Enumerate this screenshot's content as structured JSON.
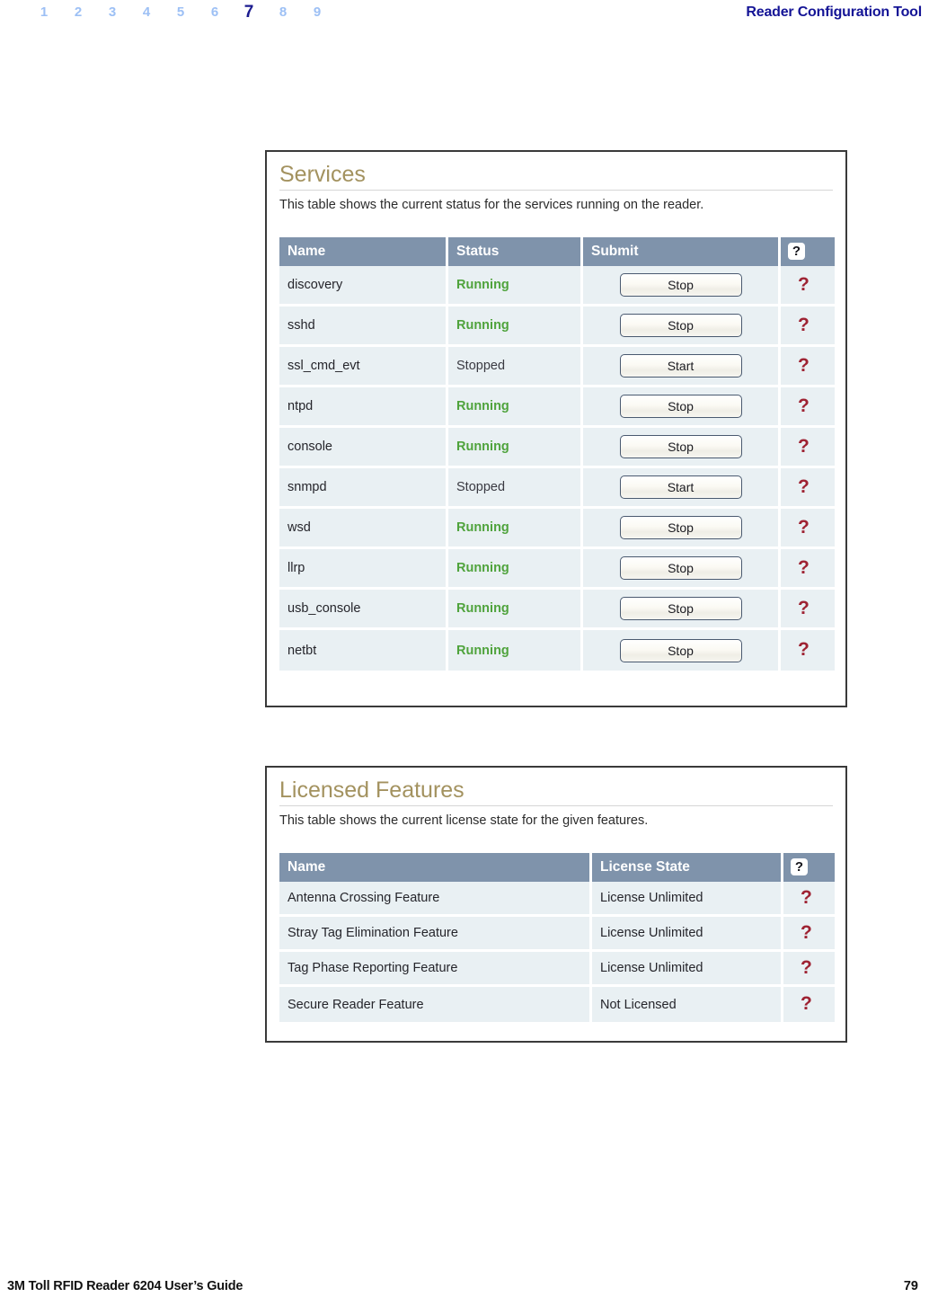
{
  "header": {
    "chapters": [
      "1",
      "2",
      "3",
      "4",
      "5",
      "6",
      "7",
      "8",
      "9"
    ],
    "current_chapter": "7",
    "title": "Reader Configuration Tool"
  },
  "services_panel": {
    "title": "Services",
    "description": "This table shows the current status for the services running on the reader.",
    "columns": {
      "name": "Name",
      "status": "Status",
      "submit": "Submit",
      "help": "?"
    },
    "rows": [
      {
        "name": "discovery",
        "status": "Running",
        "state": "running",
        "button": "Stop",
        "help": "?"
      },
      {
        "name": "sshd",
        "status": "Running",
        "state": "running",
        "button": "Stop",
        "help": "?"
      },
      {
        "name": "ssl_cmd_evt",
        "status": "Stopped",
        "state": "stopped",
        "button": "Start",
        "help": "?"
      },
      {
        "name": "ntpd",
        "status": "Running",
        "state": "running",
        "button": "Stop",
        "help": "?"
      },
      {
        "name": "console",
        "status": "Running",
        "state": "running",
        "button": "Stop",
        "help": "?"
      },
      {
        "name": "snmpd",
        "status": "Stopped",
        "state": "stopped",
        "button": "Start",
        "help": "?"
      },
      {
        "name": "wsd",
        "status": "Running",
        "state": "running",
        "button": "Stop",
        "help": "?"
      },
      {
        "name": "llrp",
        "status": "Running",
        "state": "running",
        "button": "Stop",
        "help": "?"
      },
      {
        "name": "usb_console",
        "status": "Running",
        "state": "running",
        "button": "Stop",
        "help": "?"
      },
      {
        "name": "netbt",
        "status": "Running",
        "state": "running",
        "button": "Stop",
        "help": "?"
      }
    ]
  },
  "licensed_panel": {
    "title": "Licensed Features",
    "description": "This table shows the current license state for the given features.",
    "columns": {
      "name": "Name",
      "state": "License State",
      "help": "?"
    },
    "rows": [
      {
        "name": "Antenna Crossing Feature",
        "state": "License Unlimited",
        "help": "?"
      },
      {
        "name": "Stray Tag Elimination Feature",
        "state": "License Unlimited",
        "help": "?"
      },
      {
        "name": "Tag Phase Reporting Feature",
        "state": "License Unlimited",
        "help": "?"
      },
      {
        "name": "Secure Reader Feature",
        "state": "Not Licensed",
        "help": "?"
      }
    ]
  },
  "footer": {
    "guide": "3M Toll RFID Reader 6204 User’s Guide",
    "page": "79"
  },
  "colors": {
    "table_header_bg": "#7f93ab",
    "row_bg": "#e9f0f3",
    "status_running": "#4fa33c",
    "status_stopped": "#3a3a42",
    "panel_title": "#a3925f",
    "help_mark": "#9e2232",
    "chapter_current": "#1b1b8f",
    "chapter_inactive": "#9dc0f5",
    "header_title": "#141496"
  }
}
